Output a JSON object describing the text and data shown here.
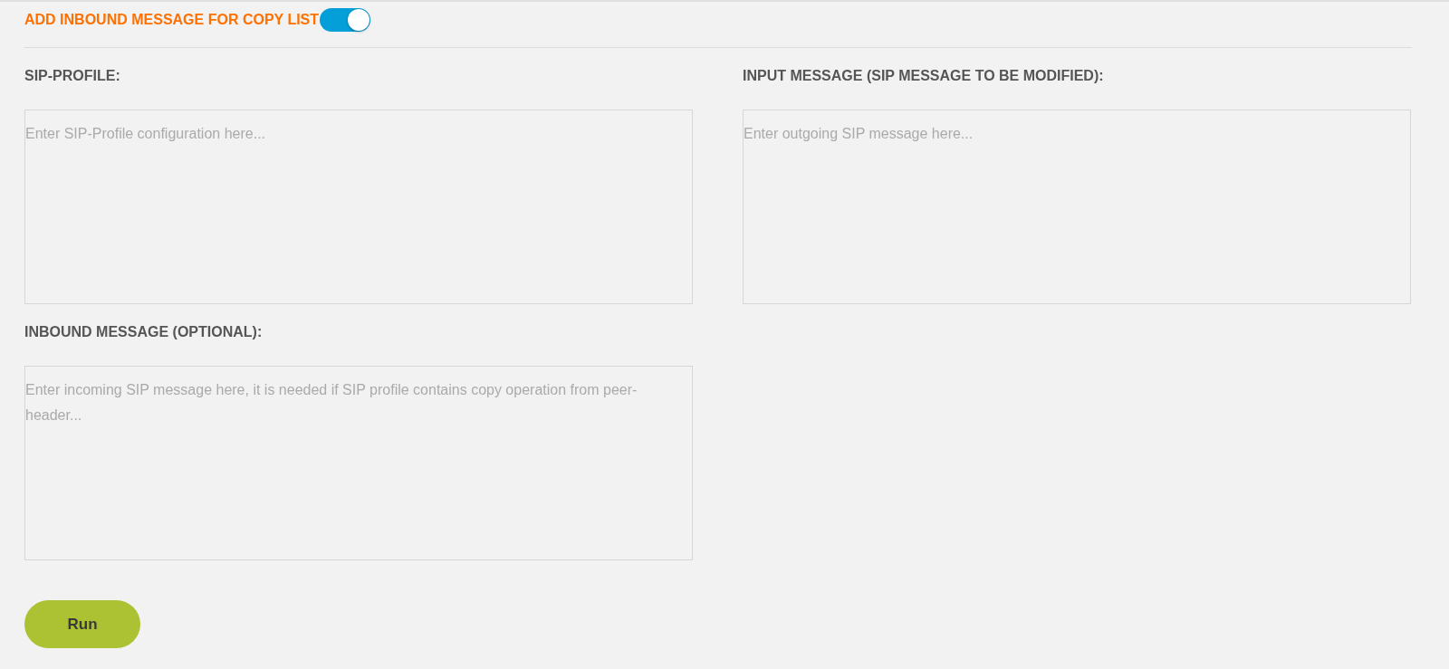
{
  "toggle": {
    "label": "ADD INBOUND MESSAGE FOR COPY LIST",
    "on": true
  },
  "fields": [
    {
      "label": "SIP-PROFILE:",
      "placeholder": "Enter SIP-Profile configuration here..."
    },
    {
      "label": "INPUT MESSAGE (SIP MESSAGE TO BE MODIFIED):",
      "placeholder": "Enter outgoing SIP message here..."
    },
    {
      "label": "INBOUND MESSAGE (OPTIONAL):",
      "placeholder": "Enter incoming SIP message here, it is needed if SIP profile contains copy operation from peer-header..."
    }
  ],
  "run_button": "Run"
}
